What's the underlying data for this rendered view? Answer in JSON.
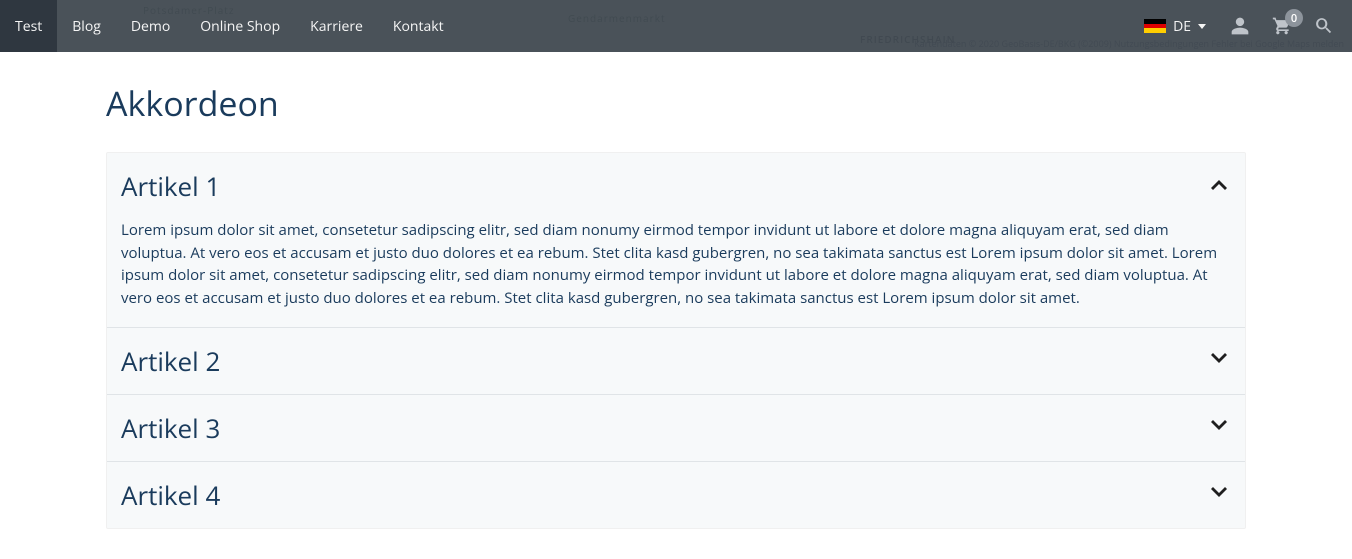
{
  "nav": {
    "items": [
      {
        "label": "Test",
        "active": true
      },
      {
        "label": "Blog",
        "active": false
      },
      {
        "label": "Demo",
        "active": false
      },
      {
        "label": "Online Shop",
        "active": false
      },
      {
        "label": "Karriere",
        "active": false
      },
      {
        "label": "Kontakt",
        "active": false
      }
    ],
    "language": "DE",
    "cart_count": "0"
  },
  "map": {
    "district": "FRIEDRICHSHAIN",
    "place1": "Potsdamer-Platz",
    "place2": "Gendarmenmarkt",
    "attribution": "Kartendaten © 2020 GeoBasis-DE/BKG (©2009)   Nutzungsbedingungen   Fehler bei Google Maps melden"
  },
  "section_title": "Akkordeon",
  "accordion": [
    {
      "title": "Artikel 1",
      "open": true,
      "body": "Lorem ipsum dolor sit amet, consetetur sadipscing elitr, sed diam nonumy eirmod tempor invidunt ut labore et dolore magna aliquyam erat, sed diam voluptua. At vero eos et accusam et justo duo dolores et ea rebum. Stet clita kasd gubergren, no sea takimata sanctus est Lorem ipsum dolor sit amet. Lorem ipsum dolor sit amet, consetetur sadipscing elitr, sed diam nonumy eirmod tempor invidunt ut labore et dolore magna aliquyam erat, sed diam voluptua. At vero eos et accusam et justo duo dolores et ea rebum. Stet clita kasd gubergren, no sea takimata sanctus est Lorem ipsum dolor sit amet."
    },
    {
      "title": "Artikel 2",
      "open": false,
      "body": ""
    },
    {
      "title": "Artikel 3",
      "open": false,
      "body": ""
    },
    {
      "title": "Artikel 4",
      "open": false,
      "body": ""
    }
  ]
}
